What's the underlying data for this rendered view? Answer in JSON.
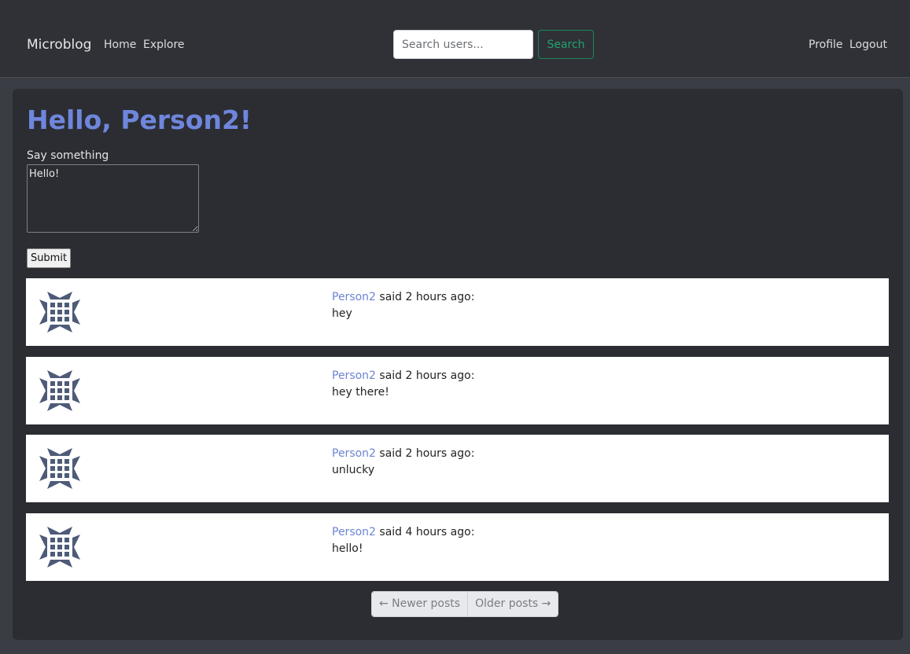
{
  "navbar": {
    "brand": "Microblog",
    "links": [
      "Home",
      "Explore"
    ],
    "search": {
      "placeholder": "Search users...",
      "button_label": "Search"
    },
    "right_links": [
      "Profile",
      "Logout"
    ]
  },
  "main": {
    "greeting": "Hello, Person2!",
    "form": {
      "label": "Say something",
      "textarea_value": "Hello!",
      "submit_label": "Submit"
    },
    "posts": [
      {
        "author": "Person2",
        "meta": " said 2 hours ago:",
        "body": "hey"
      },
      {
        "author": "Person2",
        "meta": " said 2 hours ago:",
        "body": "hey there!"
      },
      {
        "author": "Person2",
        "meta": " said 2 hours ago:",
        "body": "unlucky"
      },
      {
        "author": "Person2",
        "meta": " said 4 hours ago:",
        "body": "hello!"
      }
    ],
    "pagination": {
      "newer_label": "← Newer posts",
      "older_label": "Older posts →"
    }
  },
  "colors": {
    "background": "#3a3d44",
    "panel": "#2b2d33",
    "accent": "#6f86dc",
    "search_button": "#198754",
    "avatar": "#4e5b78"
  },
  "icons": {
    "avatar": "identicon-avatar"
  }
}
